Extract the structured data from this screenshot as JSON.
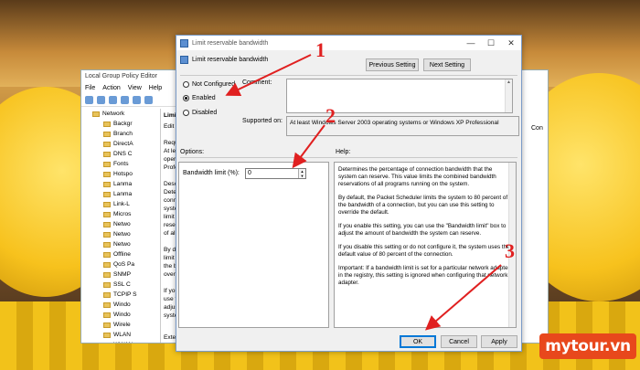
{
  "gpe": {
    "title": "Local Group Policy Editor",
    "menu": [
      "File",
      "Action",
      "View",
      "Help"
    ],
    "tree_top": "Network",
    "tree_items": [
      "Backgr",
      "Branch",
      "DirectA",
      "DNS C",
      "Fonts",
      "Hotspo",
      "Lanma",
      "Lanma",
      "Link-L",
      "Micros",
      "Netwo",
      "Netwo",
      "Netwo",
      "Offline",
      "QoS Pa",
      "SNMP",
      "SSL C",
      "TCPIP S",
      "Windo",
      "Windo",
      "Wirele",
      "WLAN",
      "WWAN"
    ],
    "mid_title": "Limi",
    "mid_lines": [
      "Edit p",
      "",
      "Requ",
      "At lea",
      "opera",
      "Profe",
      "",
      "Desc",
      "Deter",
      "conn",
      "syste",
      "limit",
      "reser",
      "of all",
      "",
      "By de",
      "limit",
      "the b",
      "overr",
      "",
      "If you",
      "use t",
      "adjus",
      "syste"
    ],
    "bottom_tab": "Exte",
    "right_label": "Con"
  },
  "dialog": {
    "title": "Limit reservable bandwidth",
    "header": "Limit reservable bandwidth",
    "prev_setting": "Previous Setting",
    "next_setting": "Next Setting",
    "radios": [
      "Not Configured",
      "Enabled",
      "Disabled"
    ],
    "selected": "Enabled",
    "comment_label": "Comment:",
    "supported_label": "Supported on:",
    "supported_value": "At least Windows Server 2003 operating systems or Windows XP Professional",
    "options_label": "Options:",
    "help_label": "Help:",
    "bandwidth_label": "Bandwidth limit (%):",
    "bandwidth_value": "0",
    "help_paragraphs": [
      "Determines the percentage of connection bandwidth that the system can reserve. This value limits the combined bandwidth reservations of all programs running on the system.",
      "By default, the Packet Scheduler limits the system to 80 percent of the bandwidth of a connection, but you can use this setting to override the default.",
      "If you enable this setting, you can use the \"Bandwidth limit\" box to adjust the amount of bandwidth the system can reserve.",
      "If you disable this setting or do not configure it, the system uses the default value of 80 percent of the connection.",
      "Important: If a bandwidth limit is set for a particular network adapter in the registry, this setting is ignored when configuring that network adapter."
    ],
    "ok": "OK",
    "cancel": "Cancel",
    "apply": "Apply"
  },
  "annotations": [
    "1",
    "2",
    "3"
  ],
  "logo": "mytour.vn",
  "colors": {
    "annotation": "#e02020",
    "logo_bg": "#e8481c",
    "accent": "#0078d7"
  }
}
